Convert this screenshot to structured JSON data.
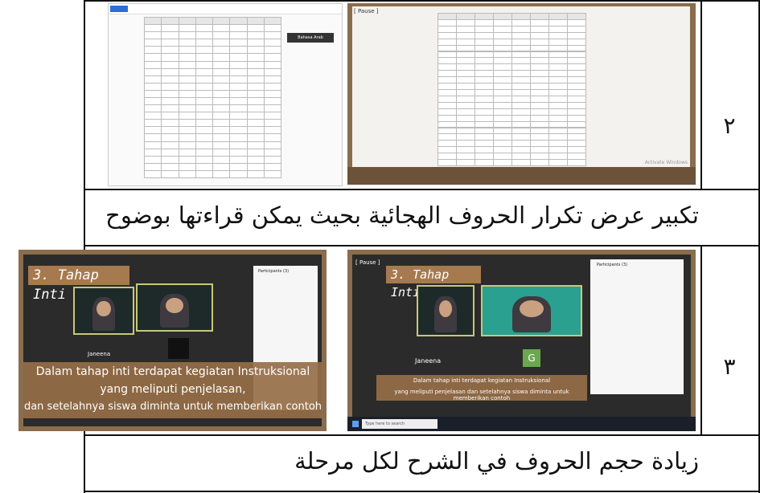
{
  "rows": [
    {
      "number": "٢",
      "caption": "تكبير عرض تكرار الحروف الهجائية بحيث يمكن قراءتها بوضوح",
      "left_screenshot": {
        "type": "zoom-table-view",
        "toolbar_label": "[ Pause ]",
        "watermark": "Activate Windows"
      },
      "right_screenshot": {
        "type": "editor-table-view",
        "sidebar_note": "Bahasa Arab"
      }
    },
    {
      "number": "٣",
      "caption": "زيادة حجم الحروف في الشرح لكل مرحلة",
      "left_screenshot": {
        "type": "zoom-meeting",
        "pause_label": "[ Pause ]",
        "slide_title": "3. Tahap Inti",
        "participant_name": "Janeena",
        "avatar_letter": "G",
        "subtitle_line1": "Dalam tahap inti terdapat kegiatan Instruksional",
        "subtitle_line2": "yang meliputi penjelasan dan setelahnya siswa diminta untuk memberikan contoh",
        "search_placeholder": "Type here to search",
        "panel_title": "Participants (3)"
      },
      "right_screenshot": {
        "type": "zoom-meeting",
        "slide_title": "3. Tahap Inti",
        "participant_name": "Janeena",
        "subtitle_line1": "Dalam tahap inti terdapat kegiatan Instruksional",
        "subtitle_line2": "yang meliputi penjelasan,",
        "subtitle_line3": "dan setelahnya siswa diminta untuk memberikan contoh",
        "panel_title": "Participants (3)"
      }
    }
  ]
}
